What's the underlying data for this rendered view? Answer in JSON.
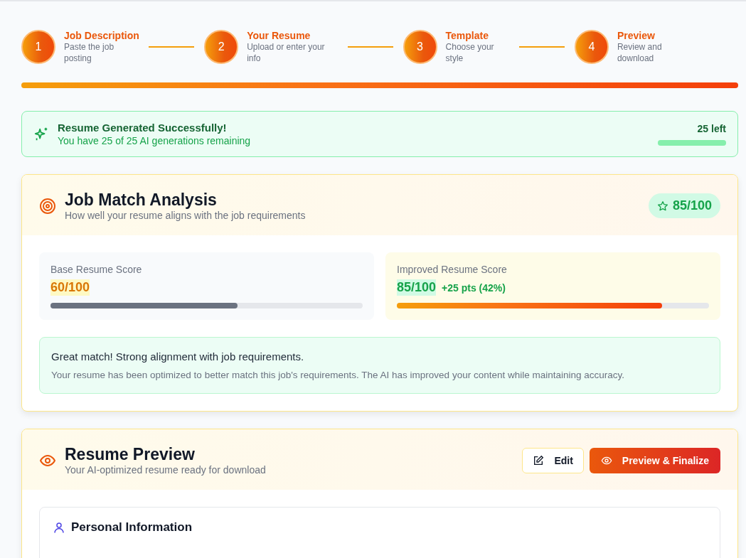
{
  "steps": [
    {
      "number": "1",
      "title": "Job Description",
      "subtitle": "Paste the job posting"
    },
    {
      "number": "2",
      "title": "Your Resume",
      "subtitle": "Upload or enter your info"
    },
    {
      "number": "3",
      "title": "Template",
      "subtitle": "Choose your style"
    },
    {
      "number": "4",
      "title": "Preview",
      "subtitle": "Review and download"
    }
  ],
  "step_progress": {
    "level": 1
  },
  "banner": {
    "title": "Resume Generated Successfully!",
    "message": "You have 25 of 25 AI generations remaining",
    "count": "25 left",
    "level": 1
  },
  "match": {
    "title": "Job Match Analysis",
    "subtitle": "How well your resume aligns with the job requirements",
    "badge": "85/100",
    "scores": [
      {
        "kind": "base",
        "label": "Base Resume Score",
        "value": "60/100",
        "level": 0.6
      },
      {
        "kind": "improved",
        "label": "Improved Resume Score",
        "value": "85/100",
        "delta": "+25 pts (42%)",
        "level": 0.85
      }
    ],
    "verdict": {
      "title": "Great match! Strong alignment with job requirements.",
      "text": "Your resume has been optimized to better match this job's requirements. The AI has improved your content while maintaining accuracy."
    }
  },
  "preview": {
    "title": "Resume Preview",
    "subtitle": "Your AI-optimized resume ready for download",
    "buttons": [
      {
        "kind": "outline",
        "label": "Edit"
      },
      {
        "kind": "primary",
        "label": "Preview & Finalize"
      }
    ],
    "section": "Personal Information"
  }
}
